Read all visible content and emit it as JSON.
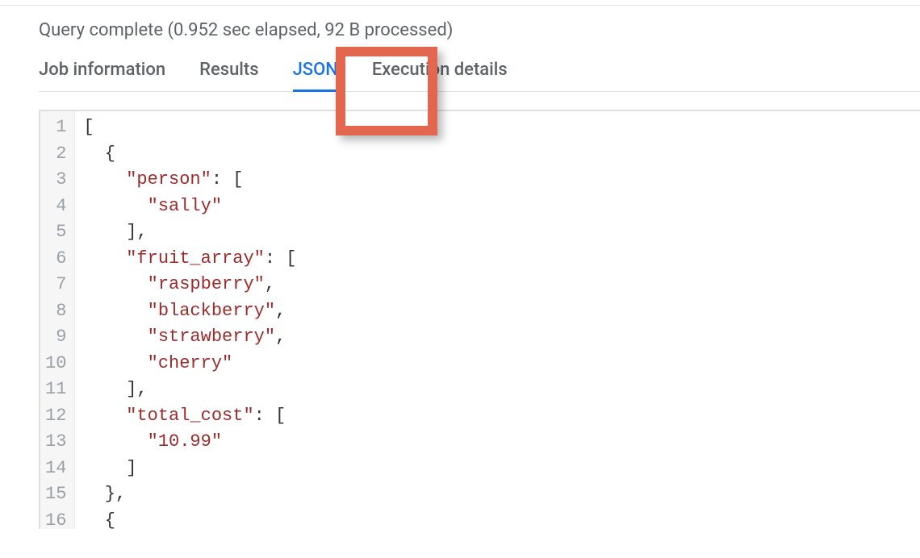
{
  "status": "Query complete (0.952 sec elapsed, 92 B processed)",
  "tabs": {
    "job_info": "Job information",
    "results": "Results",
    "json": "JSON",
    "exec": "Execution details"
  },
  "code": {
    "line_numbers": [
      "1",
      "2",
      "3",
      "4",
      "5",
      "6",
      "7",
      "8",
      "9",
      "10",
      "11",
      "12",
      "13",
      "14",
      "15",
      "16"
    ],
    "tokens": [
      [
        {
          "t": "[",
          "c": "p"
        }
      ],
      [
        {
          "t": "  {",
          "c": "p"
        }
      ],
      [
        {
          "t": "    ",
          "c": "p"
        },
        {
          "t": "\"person\"",
          "c": "k"
        },
        {
          "t": ": [",
          "c": "p"
        }
      ],
      [
        {
          "t": "      ",
          "c": "p"
        },
        {
          "t": "\"sally\"",
          "c": "s"
        }
      ],
      [
        {
          "t": "    ],",
          "c": "p"
        }
      ],
      [
        {
          "t": "    ",
          "c": "p"
        },
        {
          "t": "\"fruit_array\"",
          "c": "k"
        },
        {
          "t": ": [",
          "c": "p"
        }
      ],
      [
        {
          "t": "      ",
          "c": "p"
        },
        {
          "t": "\"raspberry\"",
          "c": "s"
        },
        {
          "t": ",",
          "c": "p"
        }
      ],
      [
        {
          "t": "      ",
          "c": "p"
        },
        {
          "t": "\"blackberry\"",
          "c": "s"
        },
        {
          "t": ",",
          "c": "p"
        }
      ],
      [
        {
          "t": "      ",
          "c": "p"
        },
        {
          "t": "\"strawberry\"",
          "c": "s"
        },
        {
          "t": ",",
          "c": "p"
        }
      ],
      [
        {
          "t": "      ",
          "c": "p"
        },
        {
          "t": "\"cherry\"",
          "c": "s"
        }
      ],
      [
        {
          "t": "    ],",
          "c": "p"
        }
      ],
      [
        {
          "t": "    ",
          "c": "p"
        },
        {
          "t": "\"total_cost\"",
          "c": "k"
        },
        {
          "t": ": [",
          "c": "p"
        }
      ],
      [
        {
          "t": "      ",
          "c": "p"
        },
        {
          "t": "\"10.99\"",
          "c": "s"
        }
      ],
      [
        {
          "t": "    ]",
          "c": "p"
        }
      ],
      [
        {
          "t": "  },",
          "c": "p"
        }
      ],
      [
        {
          "t": "  {",
          "c": "p"
        }
      ]
    ]
  }
}
